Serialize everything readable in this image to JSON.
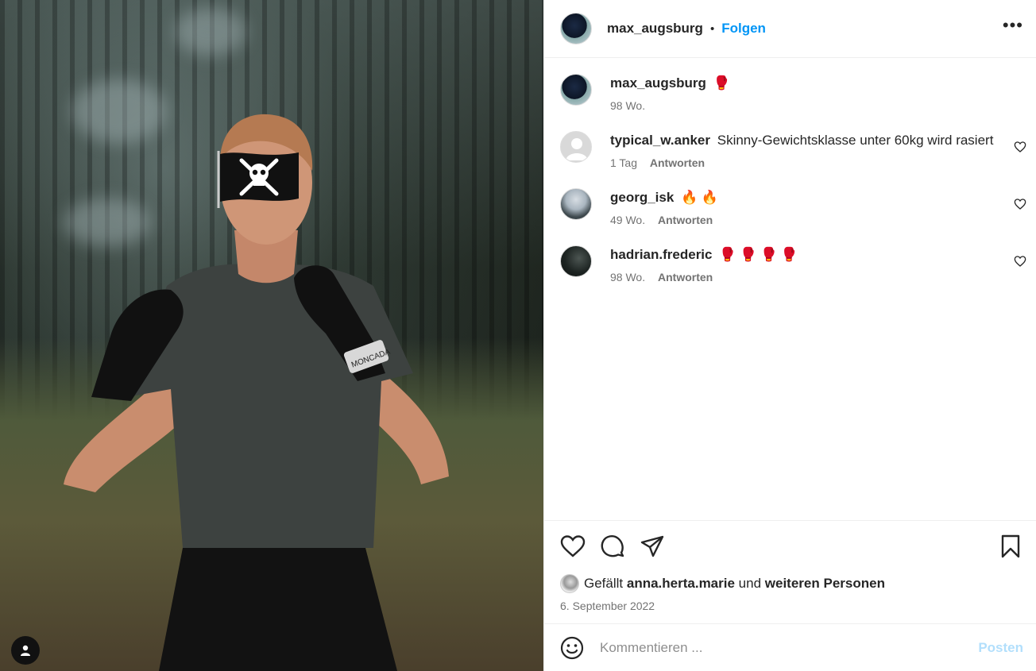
{
  "header": {
    "username": "max_augsburg",
    "separator": "•",
    "follow_label": "Folgen",
    "more_label": "•••"
  },
  "caption": {
    "username": "max_augsburg",
    "emoji": "🥊",
    "time": "98 Wo."
  },
  "comments": [
    {
      "username": "typical_w.anker",
      "text": "Skinny-Gewichtsklasse unter 60kg wird rasiert",
      "time": "1 Tag",
      "reply_label": "Antworten"
    },
    {
      "username": "georg_isk",
      "text": "🔥 🔥",
      "time": "49 Wo.",
      "reply_label": "Antworten"
    },
    {
      "username": "hadrian.frederic",
      "text": "🥊 🥊 🥊 🥊",
      "time": "98 Wo.",
      "reply_label": "Antworten"
    }
  ],
  "likes": {
    "prefix": "Gefällt",
    "user": "anna.herta.marie",
    "middle": "und",
    "others": "weiteren Personen"
  },
  "date": "6. September 2022",
  "composer": {
    "placeholder": "Kommentieren ...",
    "post_label": "Posten"
  },
  "icons": {
    "like": "heart-icon",
    "comment": "speech-bubble-icon",
    "share": "paper-plane-icon",
    "save": "bookmark-icon",
    "emoji": "smiley-icon",
    "user_tag": "person-icon",
    "flag": "pirate-flag-icon"
  },
  "colors": {
    "accent": "#0095f6",
    "post_disabled": "#b2dffc",
    "meta": "#737373"
  }
}
